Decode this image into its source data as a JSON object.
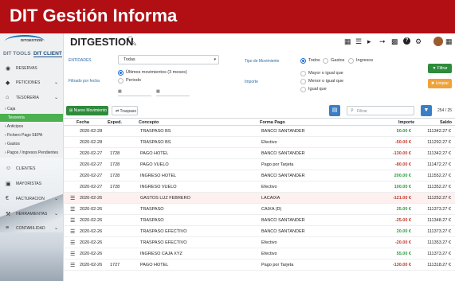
{
  "banner": {
    "title": "DIT Gestión Informa"
  },
  "sidebar": {
    "logo_text": "DITGESTION",
    "tabs": [
      "DIT TOOLS",
      "DIT CLIENT"
    ],
    "items": [
      {
        "label": "RESERVAS",
        "icon": "eye-icon",
        "chevron": false
      },
      {
        "label": "PETICIONES",
        "icon": "tag-icon",
        "chevron": true
      },
      {
        "label": "TESORERIA",
        "icon": "bank-icon",
        "chevron": true
      }
    ],
    "subitems": [
      {
        "label": "› Caja",
        "active": false
      },
      {
        "label": "Tesorería",
        "active": true
      },
      {
        "label": "› Anticipos",
        "active": false
      },
      {
        "label": "› Fichero Pago SEPA",
        "active": false
      },
      {
        "label": "› Gastos",
        "active": false
      },
      {
        "label": "› Pagos / Ingresos Pendientes",
        "active": false
      }
    ],
    "items2": [
      {
        "label": "CLIENTES",
        "icon": "users-icon",
        "chevron": false
      },
      {
        "label": "MAYORISTAS",
        "icon": "briefcase-icon",
        "chevron": false
      },
      {
        "label": "FACTURACION",
        "icon": "euro-icon",
        "chevron": true
      },
      {
        "label": "HERRAMIENTAS",
        "icon": "wrench-icon",
        "chevron": true
      },
      {
        "label": "CONTABILIDAD",
        "icon": "ledger-icon",
        "chevron": true
      }
    ]
  },
  "header": {
    "title": "DITGESTION"
  },
  "filters": {
    "entidades_label": "ENTIDADES",
    "entidades_value": "Todas",
    "filtrado_label": "Filtrado por fecha",
    "fecha_options": [
      "Últimos movimientos (3 meses)",
      "Periodo"
    ],
    "tipo_label": "Tipo de Movimiento",
    "tipo_options": [
      "Todos",
      "Gastos",
      "Ingresos"
    ],
    "importe_label": "Importe",
    "importe_options": [
      "Mayor o igual que",
      "Menor o igual que",
      "Igual que"
    ],
    "filtrar_label": "Filtrar",
    "limpiar_label": "Limpiar"
  },
  "toolbar": {
    "new_label": "Nuevo Movimiento",
    "traspaso_label": "Traspaso",
    "filter_placeholder": "Filtrar",
    "pager": "254 / 25"
  },
  "table": {
    "headers": [
      "Fecha",
      "Exped.",
      "Concepto",
      "Forma Pago",
      "Importe",
      "Saldo"
    ],
    "rows": [
      {
        "menu": false,
        "fecha": "2020-02-28",
        "exped": "",
        "concepto": "TRASPASO BS",
        "forma": "BANCO SANTANDER",
        "importe": "50.00 €",
        "neg": false,
        "saldo": "111342.27 €",
        "hl": false
      },
      {
        "menu": false,
        "fecha": "2020-02-28",
        "exped": "",
        "concepto": "TRASPASO BS",
        "forma": "Efectivo",
        "importe": "-50.00 €",
        "neg": true,
        "saldo": "111292.27 €",
        "hl": false
      },
      {
        "menu": false,
        "fecha": "2020-02-27",
        "exped": "1728",
        "concepto": "PAGO HOTEL",
        "forma": "BANCO SANTANDER",
        "importe": "-130.00 €",
        "neg": true,
        "saldo": "111342.27 €",
        "hl": false
      },
      {
        "menu": false,
        "fecha": "2020-02-27",
        "exped": "1728",
        "concepto": "PAGO VUELO",
        "forma": "Pago por Tarjeta",
        "importe": "-80.00 €",
        "neg": true,
        "saldo": "111472.27 €",
        "hl": false
      },
      {
        "menu": false,
        "fecha": "2020-02-27",
        "exped": "1728",
        "concepto": "INGRESO HOTEL",
        "forma": "BANCO SANTANDER",
        "importe": "200.00 €",
        "neg": false,
        "saldo": "111552.27 €",
        "hl": false
      },
      {
        "menu": false,
        "fecha": "2020-02-27",
        "exped": "1728",
        "concepto": "INGRESO VUELO",
        "forma": "Efectivo",
        "importe": "100.00 €",
        "neg": false,
        "saldo": "111352.27 €",
        "hl": false
      },
      {
        "menu": true,
        "fecha": "2020-02-26",
        "exped": "",
        "concepto": "GASTOS LUZ FEBRERO",
        "forma": "LACAIXA",
        "importe": "-121.00 €",
        "neg": true,
        "saldo": "111252.27 €",
        "hl": true
      },
      {
        "menu": true,
        "fecha": "2020-02-26",
        "exped": "",
        "concepto": "TRASPASO",
        "forma": "CAIXA (D)",
        "importe": "25.00 €",
        "neg": false,
        "saldo": "111373.27 €",
        "hl": false
      },
      {
        "menu": true,
        "fecha": "2020-02-26",
        "exped": "",
        "concepto": "TRASPASO",
        "forma": "BANCO SANTANDER",
        "importe": "-25.00 €",
        "neg": true,
        "saldo": "111348.27 €",
        "hl": false
      },
      {
        "menu": true,
        "fecha": "2020-02-26",
        "exped": "",
        "concepto": "TRASPASO EFECTIVO",
        "forma": "BANCO SANTANDER",
        "importe": "20.00 €",
        "neg": false,
        "saldo": "111373.27 €",
        "hl": false
      },
      {
        "menu": true,
        "fecha": "2020-02-26",
        "exped": "",
        "concepto": "TRASPASO EFECTIVO",
        "forma": "Efectivo",
        "importe": "-20.00 €",
        "neg": true,
        "saldo": "111353.27 €",
        "hl": false
      },
      {
        "menu": true,
        "fecha": "2020-02-26",
        "exped": "",
        "concepto": "INGRESO CAJA XYZ",
        "forma": "Efectivo",
        "importe": "55.00 €",
        "neg": false,
        "saldo": "111373.27 €",
        "hl": false
      },
      {
        "menu": true,
        "fecha": "2020-02-26",
        "exped": "1727",
        "concepto": "PAGO HOTEL",
        "forma": "Pago por Tarjeta",
        "importe": "-130.00 €",
        "neg": true,
        "saldo": "111318.27 €",
        "hl": false
      }
    ]
  },
  "colors": {
    "banner": "#b10f14",
    "green": "#2e8b3b",
    "blue": "#3a7fc6",
    "orange": "#f0a23a",
    "positive": "#2f9a3f",
    "negative": "#c0392b"
  }
}
